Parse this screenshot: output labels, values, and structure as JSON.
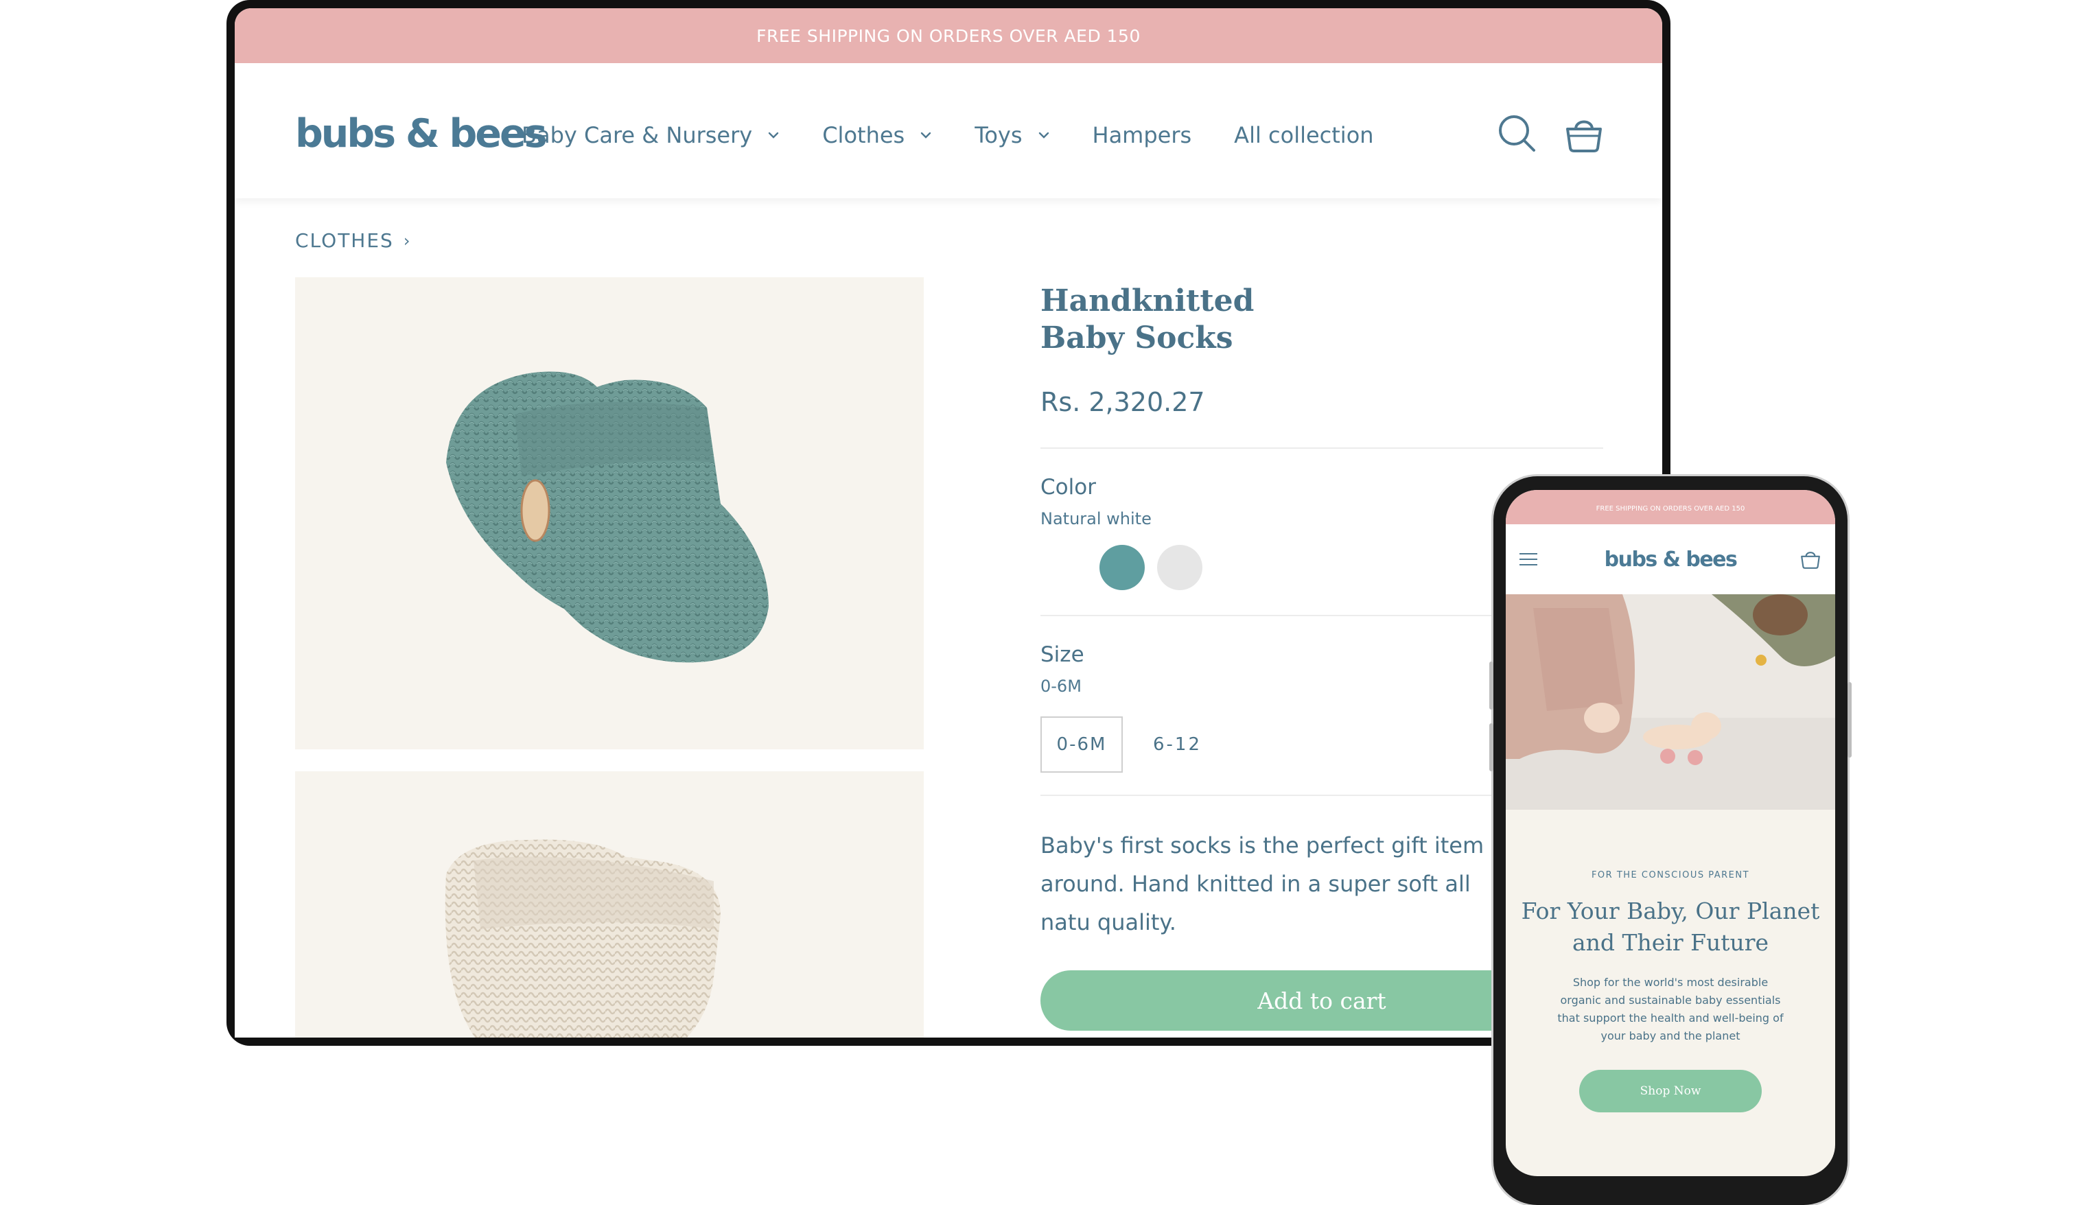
{
  "desktop": {
    "announcement": "FREE SHIPPING ON ORDERS OVER AED 150",
    "logo": "bubs & bees",
    "nav": [
      {
        "label": "Baby Care & Nursery",
        "has_dropdown": true
      },
      {
        "label": "Clothes",
        "has_dropdown": true
      },
      {
        "label": "Toys",
        "has_dropdown": true
      },
      {
        "label": "Hampers",
        "has_dropdown": false
      },
      {
        "label": "All collection",
        "has_dropdown": false
      }
    ],
    "icons": {
      "search": "search-icon",
      "cart": "basket-icon"
    },
    "breadcrumb": {
      "label": "CLOTHES",
      "separator": "›"
    },
    "product": {
      "title": "Handknitted Baby Socks",
      "price": "Rs. 2,320.27",
      "color_label": "Color",
      "color_value": "Natural white",
      "swatches": [
        {
          "name": "sage",
          "color": "#5f9ea0"
        },
        {
          "name": "natural white",
          "color": "#e6e6e6"
        }
      ],
      "size_label": "Size",
      "size_value": "0-6M",
      "sizes": [
        "0-6M",
        "6-12"
      ],
      "description": "Baby's first socks is the perfect gift item all around. Hand knitted in a super soft all natu quality.",
      "add_to_cart": "Add to cart"
    }
  },
  "mobile": {
    "announcement": "FREE SHIPPING ON ORDERS OVER AED 150",
    "logo": "bubs & bees",
    "eyebrow": "FOR THE CONSCIOUS PARENT",
    "heading": "For Your Baby, Our Planet and Their Future",
    "body": "Shop for the world's most desirable organic and sustainable baby essentials that support the health and well-being of your baby and the planet",
    "cta": "Shop Now"
  },
  "colors": {
    "accent_pink": "#e8b2b1",
    "accent_green": "#88c7a3",
    "text_blue": "#4a7288",
    "product_bg": "#f7f4ee"
  }
}
